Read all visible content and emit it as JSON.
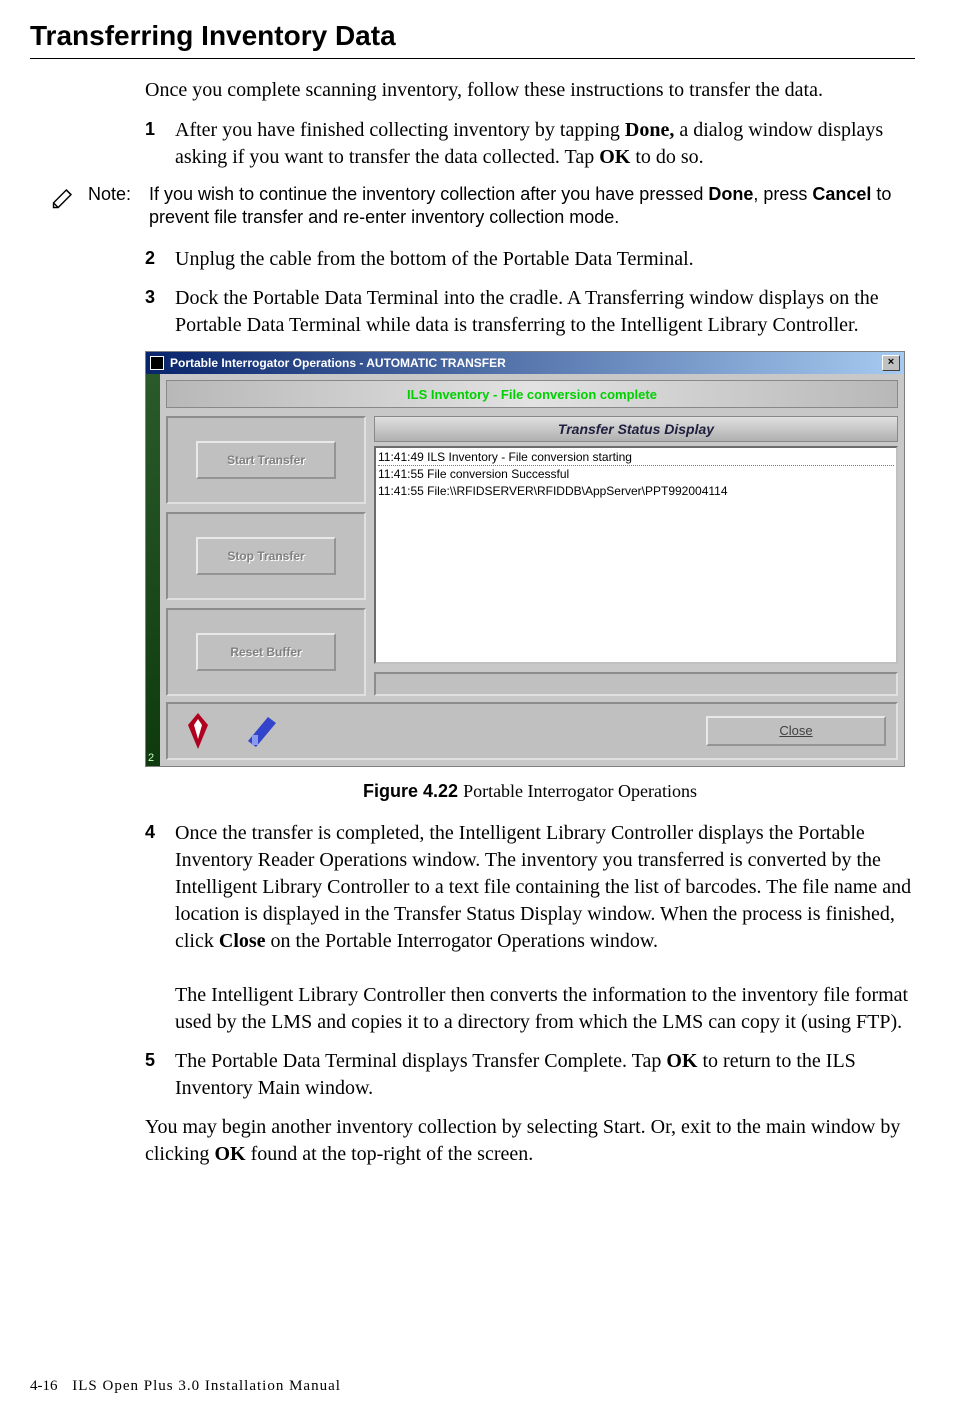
{
  "page": {
    "heading": "Transferring Inventory Data",
    "intro": "Once you complete scanning inventory, follow these instructions to transfer the data.",
    "step1_num": "1",
    "step1_a": "After you have finished collecting inventory by tapping ",
    "step1_done": "Done,",
    "step1_b": " a dialog window displays asking if you want to transfer the data collected. Tap ",
    "step1_ok": "OK",
    "step1_c": " to do so.",
    "note_label": "Note:",
    "note_a": "If you wish to continue the inventory collection after you have pressed ",
    "note_done": "Done",
    "note_b": ", press ",
    "note_cancel": "Cancel",
    "note_c": " to prevent file transfer and re-enter inventory collection mode.",
    "step2_num": "2",
    "step2_text": "Unplug the cable from the bottom of the Portable Data Terminal.",
    "step3_num": "3",
    "step3_text": "Dock the Portable Data Terminal into the cradle. A Transferring window displays on the Portable Data Terminal while data is transferring to the Intelligent Library Controller.",
    "figcap_lead": "Figure 4.22 ",
    "figcap_text": "Portable Interrogator Operations",
    "step4_num": "4",
    "step4_a": "Once the transfer is completed, the Intelligent Library Controller displays the Portable Inventory Reader Operations window. The inventory you transferred is converted by the Intelligent Library Controller to a text file containing the list of barcodes. The file name and location is displayed in the Transfer Status Display window. When the process is finished, click ",
    "step4_close": "Close",
    "step4_b": " on the Portable Interrogator Operations window.",
    "step4_para2": "The Intelligent Library Controller then converts the information to the inventory file format used by the LMS and copies it to a directory from which the LMS can copy it (using FTP).",
    "step5_num": "5",
    "step5_a": "The Portable Data Terminal displays Transfer Complete. Tap ",
    "step5_ok": "OK",
    "step5_b": " to return to the ILS Inventory Main window.",
    "tail_a": "You may begin another inventory collection by selecting Start. Or, exit to the main window by clicking ",
    "tail_ok": "OK",
    "tail_b": " found at the top-right of the screen.",
    "footer_page": "4-16",
    "footer_book": "ILS Open Plus 3.0 Installation Manual"
  },
  "app": {
    "title": "Portable Interrogator Operations  -  AUTOMATIC TRANSFER",
    "close_x": "×",
    "banner": "ILS Inventory - File conversion complete",
    "btn_start": "Start Transfer",
    "btn_stop": "Stop Transfer",
    "btn_reset": "Reset Buffer",
    "panel_title": "Transfer Status Display",
    "log": {
      "l0": "11:41:49 ILS Inventory - File conversion starting",
      "l1": "11:41:55 File conversion Successful",
      "l2": "11:41:55 File:\\\\RFIDSERVER\\RFIDDB\\AppServer\\PPT992004114"
    },
    "close_btn": "Close",
    "tiny": "2"
  }
}
